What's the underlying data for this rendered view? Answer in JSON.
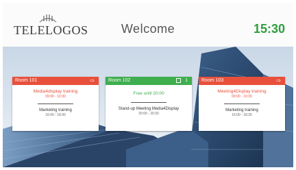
{
  "header": {
    "logo": "TELELOGOS",
    "title": "Welcome",
    "time": "15:30"
  },
  "colors": {
    "busy": "#e8503b",
    "free": "#3fae4e",
    "clock": "#2e9e3e"
  },
  "rooms": [
    {
      "name": "Room 101",
      "status": "busy",
      "icon": "arrow-icon",
      "current": {
        "title": "Media4display training",
        "time": "09:00 - 10:30"
      },
      "next": {
        "title": "Marketing training",
        "time": "16:00 - 18:30"
      }
    },
    {
      "name": "Room 102",
      "status": "free",
      "icon": "calendar-icon",
      "count": "1",
      "current": {
        "title": "Free until 20:00"
      },
      "next": {
        "title": "Stand-up Meeting Media4Display",
        "time": "20:00 - 20:30"
      }
    },
    {
      "name": "Room 103",
      "status": "busy",
      "icon": "arrow-icon",
      "current": {
        "title": "Meeting4Display training",
        "time": "09:00 - 10:30"
      },
      "next": {
        "title": "Marketing training",
        "time": "16:00 - 18:30"
      }
    }
  ]
}
